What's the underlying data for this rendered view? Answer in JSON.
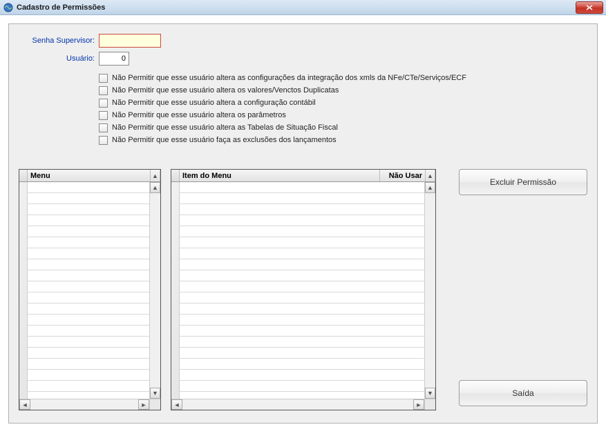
{
  "window": {
    "title": "Cadastro de Permissões"
  },
  "form": {
    "supervisor_label": "Senha Supervisor:",
    "supervisor_value": "",
    "usuario_label": "Usuário:",
    "usuario_value": "0"
  },
  "checkboxes": [
    {
      "label": "Não Permitir que esse usuário altera as configurações da integração dos xmls da NFe/CTe/Serviços/ECF",
      "checked": false
    },
    {
      "label": "Não Permitir que esse usuário altera os valores/Venctos Duplicatas",
      "checked": false
    },
    {
      "label": "Não Permitir que esse usuário altera a configuração contábil",
      "checked": false
    },
    {
      "label": "Não Permitir que esse usuário altera os parâmetros",
      "checked": false
    },
    {
      "label": "Não Permitir que esse usuário altera as Tabelas de Situação Fiscal",
      "checked": false
    },
    {
      "label": "Não Permitir que esse usuário faça as exclusões dos lançamentos",
      "checked": false
    }
  ],
  "grids": {
    "menu": {
      "columns": [
        "Menu"
      ],
      "rows": []
    },
    "items": {
      "columns": [
        "Item do Menu",
        "Não Usar"
      ],
      "rows": []
    }
  },
  "buttons": {
    "excluir": "Excluir Permissão",
    "saida": "Saída"
  }
}
